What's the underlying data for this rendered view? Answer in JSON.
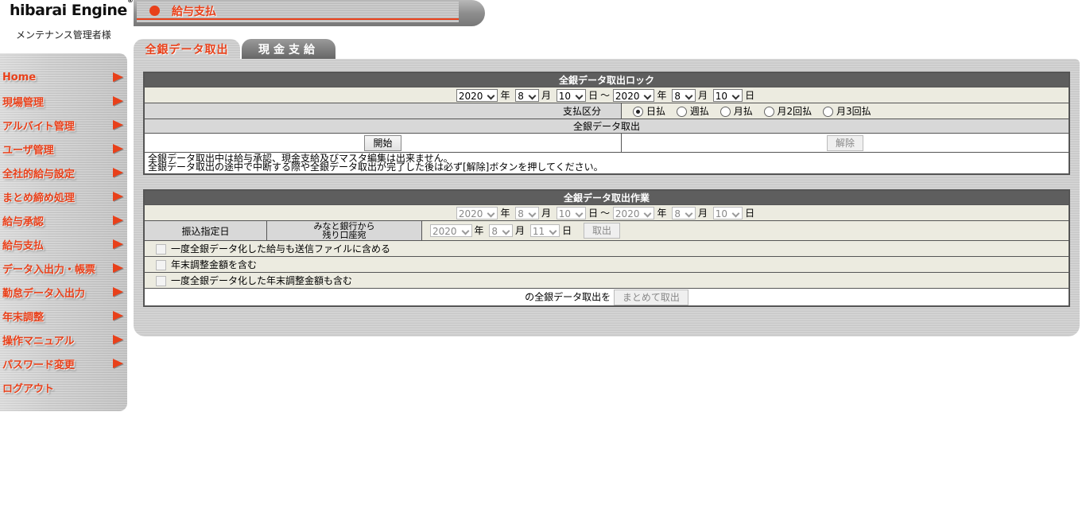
{
  "brand": {
    "logo_text_1": "hibarai ",
    "logo_e": "E",
    "logo_text_2": "ngine",
    "reg": "®",
    "user_label": "メンテナンス管理者様"
  },
  "sidebar": {
    "items": [
      {
        "label": "Home"
      },
      {
        "label": "現場管理"
      },
      {
        "label": "アルバイト管理"
      },
      {
        "label": "ユーザ管理"
      },
      {
        "label": "全社的給与設定"
      },
      {
        "label": "まとめ締め処理"
      },
      {
        "label": "給与承認"
      },
      {
        "label": "給与支払"
      },
      {
        "label": "データ入出力・帳票"
      },
      {
        "label": "勤怠データ入出力"
      },
      {
        "label": "年末調整"
      },
      {
        "label": "操作マニュアル"
      },
      {
        "label": "パスワード変更"
      },
      {
        "label": "ログアウト"
      }
    ]
  },
  "page_title": "給与支払",
  "tabs": {
    "active": "全銀データ取出",
    "inactive": "現金支給"
  },
  "lock": {
    "header": "全銀データ取出ロック",
    "from": {
      "year": "2020",
      "month": "8",
      "day": "10"
    },
    "to": {
      "year": "2020",
      "month": "8",
      "day": "10"
    },
    "unit_year": "年",
    "unit_month": "月",
    "unit_day": "日",
    "tilde": "～",
    "payment_type_label": "支払区分",
    "payment_options": [
      "日払",
      "週払",
      "月払",
      "月2回払",
      "月3回払"
    ],
    "payment_selected": "日払",
    "sub_header": "全銀データ取出",
    "start_button": "開始",
    "release_button": "解除",
    "note_line1": "全銀データ取出中は給与承認、現金支給及びマスタ編集は出来ません。",
    "note_line2": "全銀データ取出の途中で中断する際や全銀データ取出が完了した後は必ず[解除]ボタンを押してください。"
  },
  "work": {
    "header": "全銀データ取出作業",
    "from": {
      "year": "2020",
      "month": "8",
      "day": "10"
    },
    "to": {
      "year": "2020",
      "month": "8",
      "day": "10"
    },
    "transfer_date_label": "振込指定日",
    "minato_label_1": "みなと銀行から",
    "minato_label_2": "残り口座宛",
    "remain": {
      "year": "2020",
      "month": "8",
      "day": "11"
    },
    "fetch_button": "取出",
    "check1": "一度全銀データ化した給与も送信ファイルに含める",
    "check2": "年末調整金額を含む",
    "check3": "一度全銀データ化した年末調整金額も含む",
    "bulk_label": "の全銀データ取出を",
    "bulk_button": "まとめて取出"
  }
}
